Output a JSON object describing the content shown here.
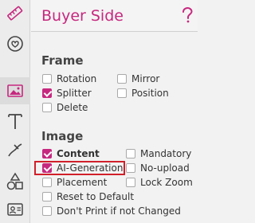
{
  "panel": {
    "title": "Buyer Side"
  },
  "frame": {
    "heading": "Frame",
    "options": [
      {
        "label": "Rotation",
        "checked": false
      },
      {
        "label": "Mirror",
        "checked": false
      },
      {
        "label": "Splitter",
        "checked": true
      },
      {
        "label": "Position",
        "checked": false
      },
      {
        "label": "Delete",
        "checked": false
      }
    ]
  },
  "image": {
    "heading": "Image",
    "options": [
      {
        "label": "Content",
        "checked": true
      },
      {
        "label": "Mandatory",
        "checked": false
      },
      {
        "label": "AI-Generation",
        "checked": true
      },
      {
        "label": "No-upload",
        "checked": false
      },
      {
        "label": "Placement",
        "checked": false
      },
      {
        "label": "Lock Zoom",
        "checked": false
      },
      {
        "label": "Reset to Default",
        "checked": false
      },
      {
        "label": "Don't Print if not Changed",
        "checked": false
      }
    ]
  },
  "colors": {
    "accent": "#c6287f",
    "highlight": "#d0202a"
  },
  "toolbar": {
    "tools": [
      "ruler-icon",
      "sticker-icon",
      "image-icon",
      "text-icon",
      "path-icon",
      "shapes-icon",
      "id-card-icon"
    ],
    "selected": "image-icon"
  }
}
